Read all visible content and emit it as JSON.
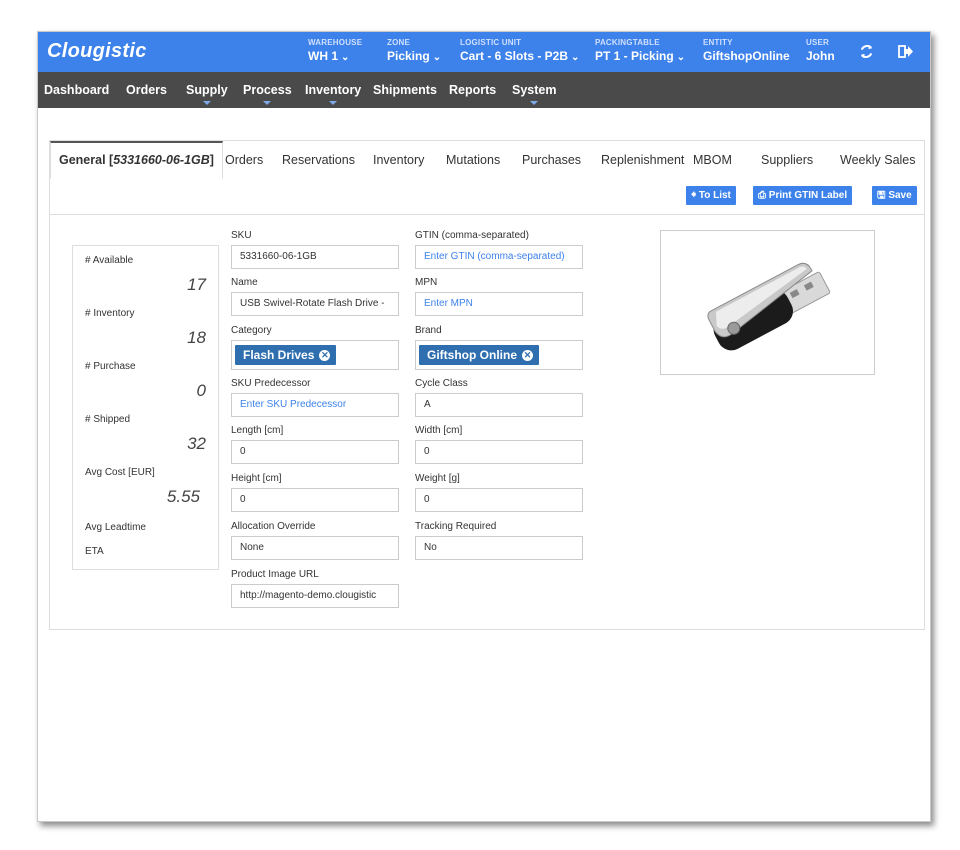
{
  "app": {
    "logo": "Clougistic"
  },
  "selectors": [
    {
      "label": "WAREHOUSE",
      "value": "WH 1",
      "chevron": true
    },
    {
      "label": "ZONE",
      "value": "Picking",
      "chevron": true
    },
    {
      "label": "LOGISTIC UNIT",
      "value": "Cart - 6 Slots - P2B",
      "chevron": true
    },
    {
      "label": "PACKINGTABLE",
      "value": "PT 1 - Picking",
      "chevron": true
    },
    {
      "label": "ENTITY",
      "value": "GiftshopOnline",
      "chevron": false
    },
    {
      "label": "USER",
      "value": "John",
      "chevron": false
    }
  ],
  "icons": {
    "refresh": "refresh-icon",
    "logout": "logout-icon"
  },
  "nav": [
    {
      "label": "Dashboard",
      "caret": false
    },
    {
      "label": "Orders",
      "caret": false
    },
    {
      "label": "Supply",
      "caret": true
    },
    {
      "label": "Process",
      "caret": true
    },
    {
      "label": "Inventory",
      "caret": true
    },
    {
      "label": "Shipments",
      "caret": false
    },
    {
      "label": "Reports",
      "caret": false
    },
    {
      "label": "System",
      "caret": true
    }
  ],
  "tabs": {
    "active": {
      "prefix": "General [",
      "id": "5331660-06-1GB",
      "suffix": "]"
    },
    "others": [
      "Orders",
      "Reservations",
      "Inventory",
      "Mutations",
      "Purchases",
      "Replenishment",
      "MBOM",
      "Suppliers",
      "Weekly Sales"
    ]
  },
  "buttons": {
    "to_list": "To List",
    "print_gtin": "Print GTIN Label",
    "save": "Save"
  },
  "stats": [
    {
      "label": "# Available",
      "value": "17"
    },
    {
      "label": "# Inventory",
      "value": "18"
    },
    {
      "label": "# Purchase",
      "value": "0"
    },
    {
      "label": "# Shipped",
      "value": "32"
    },
    {
      "label": "Avg Cost [EUR]",
      "value": "5.55"
    },
    {
      "label": "Avg Leadtime",
      "value": ""
    },
    {
      "label": "ETA",
      "value": ""
    }
  ],
  "form": {
    "sku": {
      "label": "SKU",
      "value": "5331660-06-1GB"
    },
    "gtin": {
      "label": "GTIN (comma-separated)",
      "placeholder": "Enter GTIN (comma-separated)"
    },
    "name": {
      "label": "Name",
      "value": "USB Swivel-Rotate Flash Drive -"
    },
    "mpn": {
      "label": "MPN",
      "placeholder": "Enter MPN"
    },
    "category": {
      "label": "Category",
      "tag": "Flash Drives"
    },
    "brand": {
      "label": "Brand",
      "tag": "Giftshop Online"
    },
    "sku_predecessor": {
      "label": "SKU Predecessor",
      "placeholder": "Enter SKU Predecessor"
    },
    "cycle_class": {
      "label": "Cycle Class",
      "value": "A"
    },
    "length": {
      "label": "Length [cm]",
      "value": "0"
    },
    "width": {
      "label": "Width [cm]",
      "value": "0"
    },
    "height": {
      "label": "Height [cm]",
      "value": "0"
    },
    "weight": {
      "label": "Weight [g]",
      "value": "0"
    },
    "allocation_override": {
      "label": "Allocation Override",
      "value": "None"
    },
    "tracking_required": {
      "label": "Tracking Required",
      "value": "No"
    },
    "image_url": {
      "label": "Product Image URL",
      "value": "http://magento-demo.clougistic"
    }
  },
  "colors": {
    "topbar": "#3d82ea",
    "navbar": "#4a4a4a",
    "tag": "#2f6fb0",
    "button": "#3d82ea"
  }
}
